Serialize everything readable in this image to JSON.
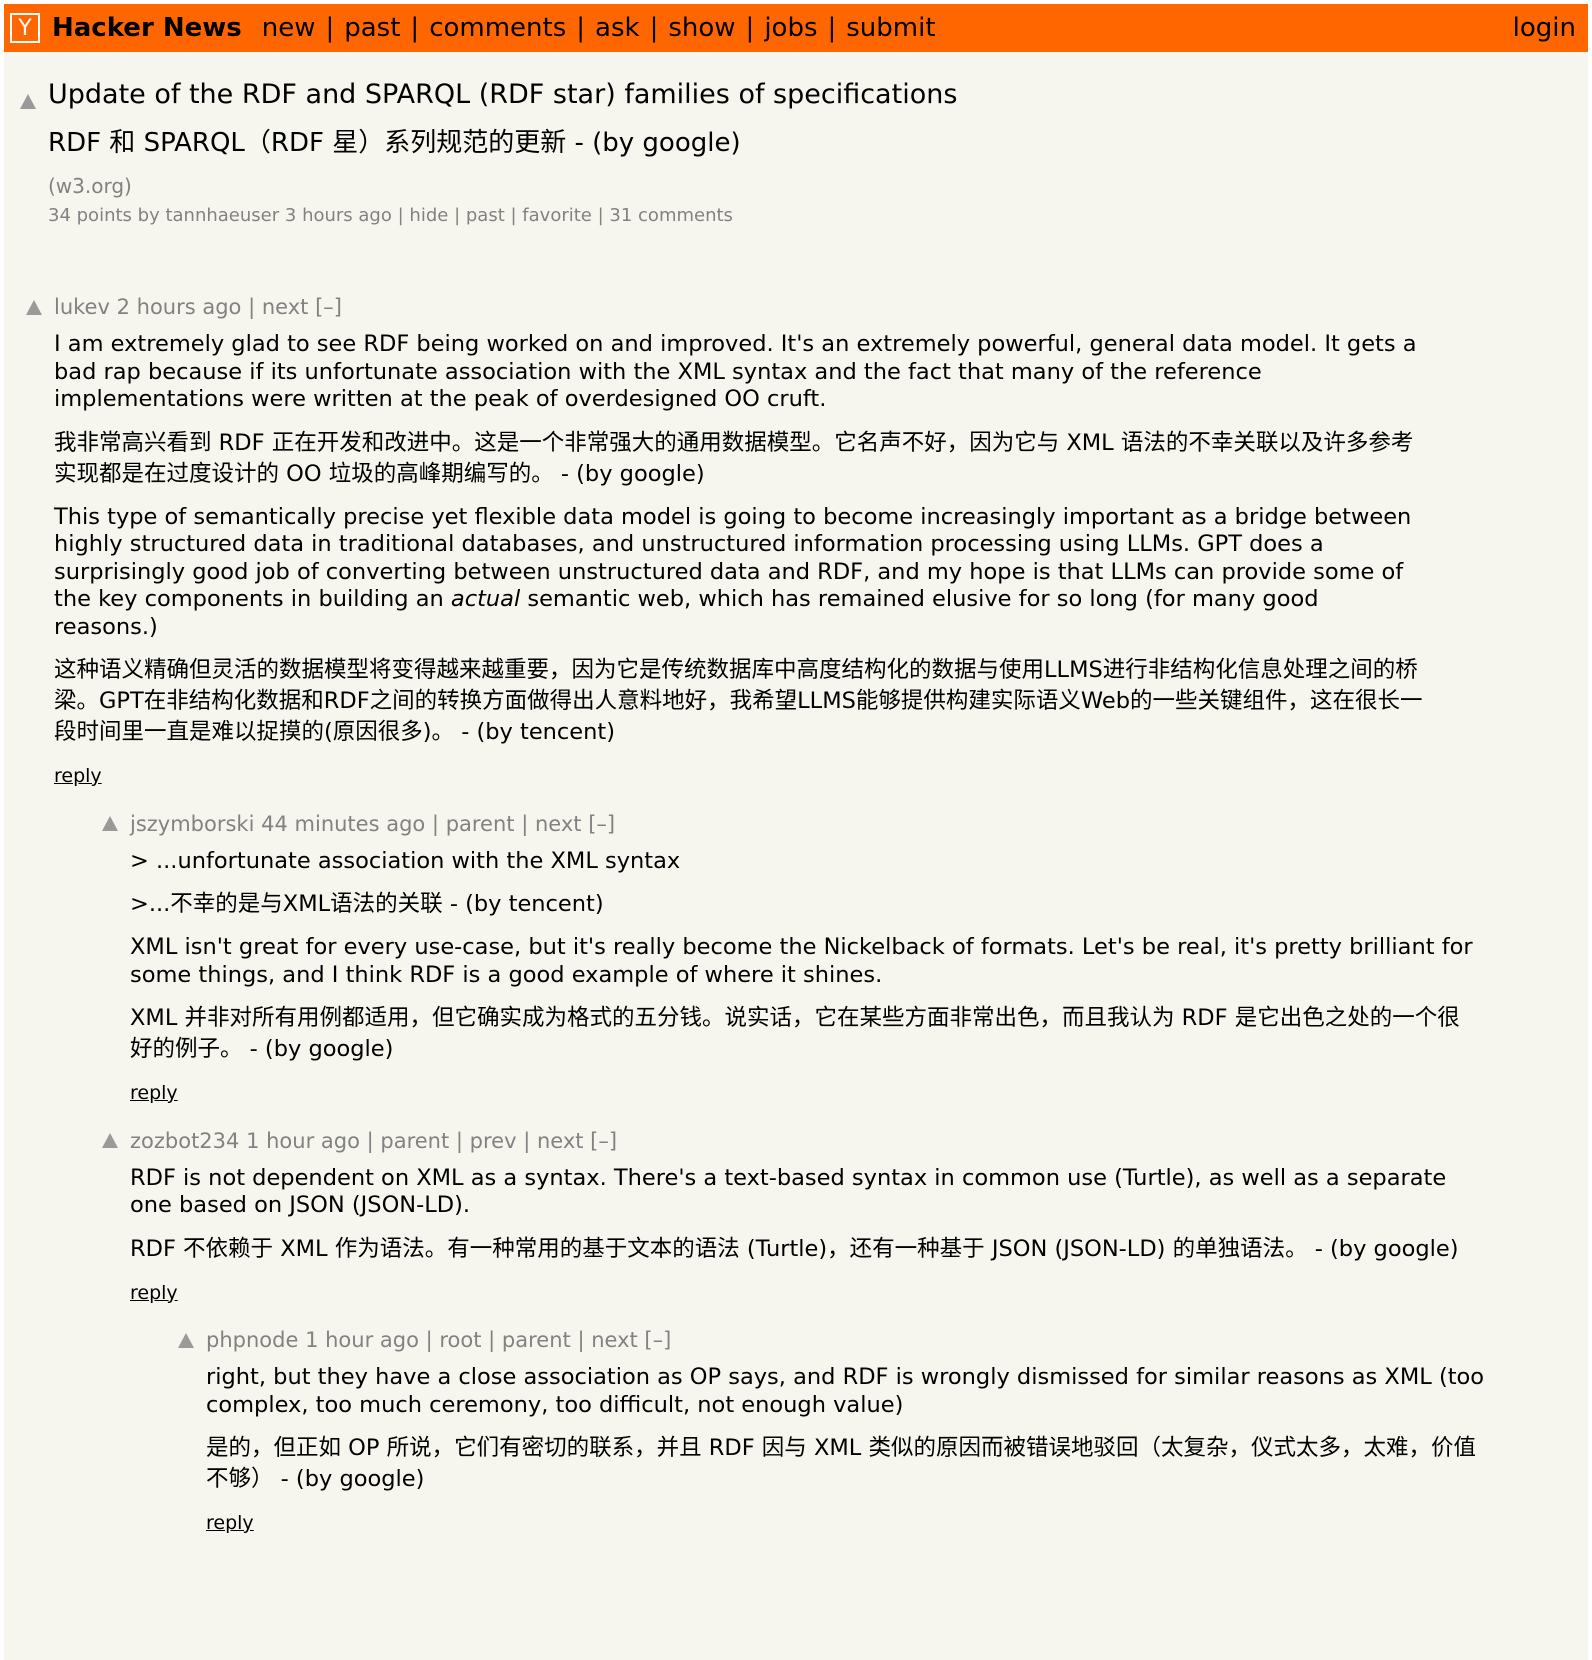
{
  "header": {
    "logo": "Y",
    "brand": "Hacker News",
    "nav": [
      "new",
      "past",
      "comments",
      "ask",
      "show",
      "jobs",
      "submit"
    ],
    "login": "login"
  },
  "story": {
    "title": "Update of the RDF and SPARQL (RDF star) families of specifications",
    "title_translated": "RDF 和 SPARQL（RDF 星）系列规范的更新 - (by google)",
    "site": "(w3.org)",
    "points": "34 points",
    "by": "by",
    "user": "tannhaeuser",
    "age": "3 hours ago",
    "links": [
      "hide",
      "past",
      "favorite",
      "31 comments"
    ]
  },
  "comments": [
    {
      "user": "lukev",
      "age": "2 hours ago",
      "nav": [
        "next",
        "[–]"
      ],
      "paragraphs": [
        "I am extremely glad to see RDF being worked on and improved. It's an extremely powerful, general data model. It gets a bad rap because if its unfortunate association with the XML syntax and the fact that many of the reference implementations were written at the peak of overdesigned OO cruft.",
        "我非常高兴看到 RDF 正在开发和改进中。这是一个非常强大的通用数据模型。它名声不好，因为它与 XML 语法的不幸关联以及许多参考实现都是在过度设计的 OO 垃圾的高峰期编写的。 - (by google)",
        "This type of semantically precise yet flexible data model is going to become increasingly important as a bridge between highly structured data in traditional databases, and unstructured information processing using LLMs. GPT does a surprisingly good job of converting between unstructured data and RDF, and my hope is that LLMs can provide some of the key components in building an ",
        "actual",
        " semantic web, which has remained elusive for so long (for many good reasons.)",
        "这种语义精确但灵活的数据模型将变得越来越重要，因为它是传统数据库中高度结构化的数据与使用LLMS进行非结构化信息处理之间的桥梁。GPT在非结构化数据和RDF之间的转换方面做得出人意料地好，我希望LLMS能够提供构建实际语义Web的一些关键组件，这在很长一段时间里一直是难以捉摸的(原因很多)。 - (by tencent)"
      ],
      "reply": "reply"
    },
    {
      "user": "jszymborski",
      "age": "44 minutes ago",
      "nav": [
        "parent",
        "next",
        "[–]"
      ],
      "paragraphs": [
        "> ...unfortunate association with the XML syntax",
        ">...不幸的是与XML语法的关联 - (by tencent)",
        "XML isn't great for every use-case, but it's really become the Nickelback of formats. Let's be real, it's pretty brilliant for some things, and I think RDF is a good example of where it shines.",
        "XML 并非对所有用例都适用，但它确实成为格式的五分钱。说实话，它在某些方面非常出色，而且我认为 RDF 是它出色之处的一个很好的例子。 - (by google)"
      ],
      "reply": "reply"
    },
    {
      "user": "zozbot234",
      "age": "1 hour ago",
      "nav": [
        "parent",
        "prev",
        "next",
        "[–]"
      ],
      "paragraphs": [
        "RDF is not dependent on XML as a syntax. There's a text-based syntax in common use (Turtle), as well as a separate one based on JSON (JSON-LD).",
        "RDF 不依赖于 XML 作为语法。有一种常用的基于文本的语法 (Turtle)，还有一种基于 JSON (JSON-LD) 的单独语法。 - (by google)"
      ],
      "reply": "reply"
    },
    {
      "user": "phpnode",
      "age": "1 hour ago",
      "nav": [
        "root",
        "parent",
        "next",
        "[–]"
      ],
      "paragraphs": [
        "right, but they have a close association as OP says, and RDF is wrongly dismissed for similar reasons as XML (too complex, too much ceremony, too difficult, not enough value)",
        "是的，但正如 OP 所说，它们有密切的联系，并且 RDF 因与 XML 类似的原因而被错误地驳回（太复杂，仪式太多，太难，价值不够） - (by google)"
      ],
      "reply": "reply"
    }
  ]
}
